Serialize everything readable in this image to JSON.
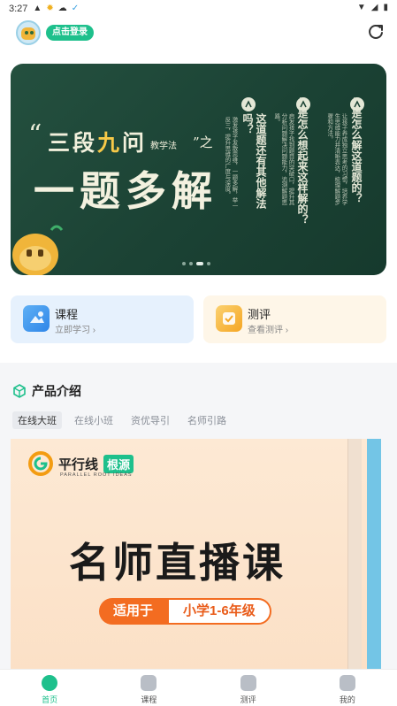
{
  "status_bar": {
    "time": "3:27"
  },
  "header": {
    "login_label": "点击登录"
  },
  "banner": {
    "quote_mark": "“",
    "title_line1_a": "三段",
    "title_line1_b": "九",
    "title_line1_c": "问",
    "title_small": "教学法",
    "title_suffix": "”之",
    "title_line2": "一题多解",
    "questions": [
      {
        "title": "你是怎么解这道题的？",
        "desc": "让孩子养成独立思考的习惯，培养学生思维能力并清晰表达，梳理解题步骤和方法。"
      },
      {
        "title": "你是怎么想起来这样解的？",
        "desc": "启发孩子找到题目的突破口，提升其分析问题解决问题能力，追溯解题思路。"
      },
      {
        "title": "这道题还有其他解法吗？",
        "desc": "激发孩子发散思维，一题多解，举一反三，提升思维的广度与深度。"
      }
    ],
    "page_count": 4,
    "active_page": 2
  },
  "cards": [
    {
      "title": "课程",
      "subtitle": "立即学习 ›"
    },
    {
      "title": "测评",
      "subtitle": "查看测评 ›"
    }
  ],
  "products": {
    "section_title": "产品介绍",
    "tabs": [
      "在线大班",
      "在线小班",
      "资优导引",
      "名师引路"
    ],
    "active_tab": 0,
    "poster": {
      "brand_name": "平行线",
      "brand_badge": "根源",
      "brand_en": "PARALLEL ROOT IDEAS",
      "title": "名师直播课",
      "applies_label": "适用于",
      "applies_value": "小学1-6年级"
    }
  },
  "bottom_nav": [
    {
      "label": "首页",
      "active": true
    },
    {
      "label": "课程",
      "active": false
    },
    {
      "label": "测评",
      "active": false
    },
    {
      "label": "我的",
      "active": false
    }
  ],
  "colors": {
    "accent": "#1ec08c",
    "banner_bg": "#1b4234",
    "poster_orange": "#f36c21"
  }
}
